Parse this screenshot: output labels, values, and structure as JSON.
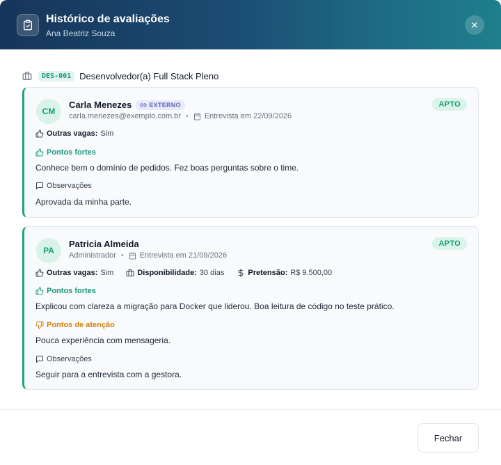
{
  "header": {
    "title": "Histórico de avaliações",
    "subtitle": "Ana Beatriz Souza"
  },
  "vaga": {
    "code": "DES-001",
    "title": "Desenvolvedor(a) Full Stack Pleno"
  },
  "evaluations": [
    {
      "initials": "CM",
      "name": "Carla Menezes",
      "badge": "EXTERNO",
      "meta": "carla.menezes@exemplo.com.br",
      "interview": "Entrevista em 22/09/2026",
      "status": "APTO",
      "outras_vagas_label": "Outras vagas:",
      "outras_vagas_value": "Sim",
      "strengths_label": "Pontos fortes",
      "strengths_text": "Conhece bem o domínio de pedidos. Fez boas perguntas sobre o time.",
      "notes_label": "Observações",
      "notes_text": "Aprovada da minha parte."
    },
    {
      "initials": "PA",
      "name": "Patricia Almeida",
      "meta": "Administrador",
      "interview": "Entrevista em 21/09/2026",
      "status": "APTO",
      "outras_vagas_label": "Outras vagas:",
      "outras_vagas_value": "Sim",
      "disponibilidade_label": "Disponibilidade:",
      "disponibilidade_value": "30 dias",
      "pretensao_label": "Pretensão:",
      "pretensao_value": "R$ 9.500,00",
      "strengths_label": "Pontos fortes",
      "strengths_text": "Explicou com clareza a migração para Docker que liderou. Boa leitura de código no teste prático.",
      "attention_label": "Pontos de atenção",
      "attention_text": "Pouca experiência com mensageria.",
      "notes_label": "Observações",
      "notes_text": "Seguir para a entrevista com a gestora."
    }
  ],
  "footer": {
    "close_label": "Fechar"
  },
  "colors": {
    "accent": "#19a37e",
    "warning": "#d4820c",
    "badge_externo": "#5b65b7"
  },
  "icons": {
    "header": "clipboard-check-icon",
    "close": "close-icon",
    "vaga": "briefcase-icon",
    "calendar": "calendar-icon",
    "thumbs_up": "thumbs-up-icon",
    "thumbs_down": "thumbs-down-icon",
    "message": "message-square-icon",
    "building": "building-icon",
    "dollar": "dollar-icon",
    "link": "link-icon"
  }
}
